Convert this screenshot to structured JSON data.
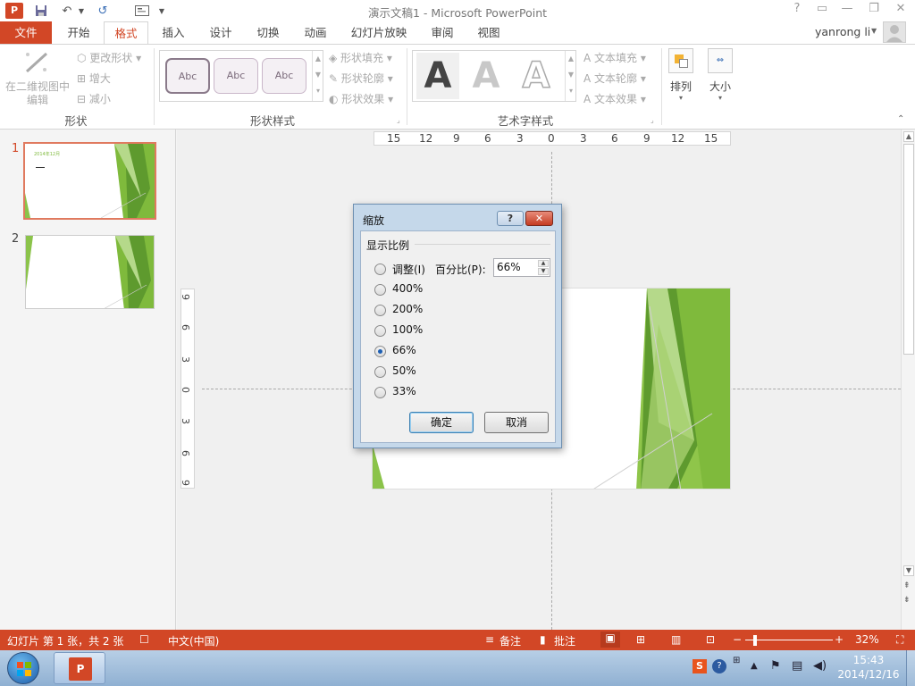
{
  "window": {
    "title": "演示文稿1 - Microsoft PowerPoint",
    "help": "?",
    "user": "yanrong li"
  },
  "quick_access": {
    "undo_label": "↶",
    "redo_label": "↺"
  },
  "tabs": [
    "文件",
    "开始",
    "格式",
    "插入",
    "设计",
    "切换",
    "动画",
    "幻灯片放映",
    "审阅",
    "视图"
  ],
  "ribbon": {
    "shapes_group": {
      "edit_in_2d": "在二维视图中编辑",
      "change_shape": "更改形状",
      "increase": "增大",
      "decrease": "减小",
      "label": "形状"
    },
    "shape_styles": {
      "samples": [
        "Abc",
        "Abc",
        "Abc"
      ],
      "fill": "形状填充",
      "outline": "形状轮廓",
      "effects": "形状效果",
      "label": "形状样式"
    },
    "wordart": {
      "letter": "A",
      "text_fill": "文本填充",
      "text_outline": "文本轮廓",
      "text_effects": "文本效果",
      "label": "艺术字样式"
    },
    "arrange": "排列",
    "size": "大小"
  },
  "slides": [
    {
      "number": "1",
      "tiny_text": "2014年12月"
    },
    {
      "number": "2"
    }
  ],
  "ruler": {
    "horizontal": [
      "15",
      "12",
      "9",
      "6",
      "3",
      "0",
      "3",
      "6",
      "9",
      "12",
      "15"
    ],
    "vertical": [
      "9",
      "6",
      "3",
      "0",
      "3",
      "6",
      "9"
    ]
  },
  "zoom_dialog": {
    "title": "缩放",
    "help": "?",
    "group_label": "显示比例",
    "options": [
      "调整(I)",
      "400%",
      "200%",
      "100%",
      "66%",
      "50%",
      "33%"
    ],
    "selected": "66%",
    "percent_label": "百分比(P):",
    "percent_value": "66%",
    "ok": "确定",
    "cancel": "取消"
  },
  "status": {
    "slide_info": "幻灯片 第 1 张，共 2 张",
    "language": "中文(中国)",
    "notes": "备注",
    "comments": "批注",
    "zoom": "32%"
  },
  "taskbar": {
    "time": "15:43",
    "date": "2014/12/16"
  },
  "colors": {
    "accent": "#d24726",
    "slide_green": "#7fba3c",
    "dialog_frame": "#c5d8ea"
  }
}
